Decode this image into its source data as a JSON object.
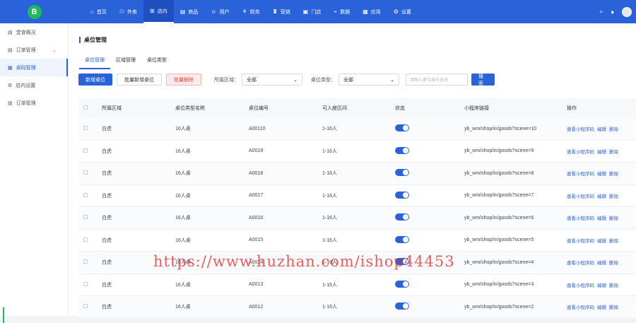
{
  "colors": {
    "primary": "#2a63d9",
    "brand": "#1fb85c",
    "danger": "#e04848"
  },
  "logo": {
    "letter": "B"
  },
  "nav": [
    {
      "icon": "⌂",
      "label": "首页"
    },
    {
      "icon": "⚇",
      "label": "外卖"
    },
    {
      "icon": "⊞",
      "label": "店内"
    },
    {
      "icon": "▤",
      "label": "商品"
    },
    {
      "icon": "☺",
      "label": "用户"
    },
    {
      "icon": "⚘",
      "label": "财务"
    },
    {
      "icon": "♜",
      "label": "营销"
    },
    {
      "icon": "▣",
      "label": "门店"
    },
    {
      "icon": "⌁",
      "label": "数据"
    },
    {
      "icon": "▦",
      "label": "应用"
    },
    {
      "icon": "⚙",
      "label": "设置"
    }
  ],
  "nav_active_index": 2,
  "sidebar": {
    "items": [
      {
        "icon": "▤",
        "label": "堂食概况"
      },
      {
        "icon": "▤",
        "label": "订单管理",
        "arrow": "⌄"
      },
      {
        "icon": "▦",
        "label": "桌码管理"
      },
      {
        "icon": "⚙",
        "label": "店内设置"
      },
      {
        "icon": "▤",
        "label": "订单管理"
      }
    ]
  },
  "page": {
    "title": "桌位管理"
  },
  "tabs": [
    "桌位管理",
    "区域管理",
    "桌位类型"
  ],
  "toolbar": {
    "add": "新增桌位",
    "batch_add": "批量新增桌位",
    "batch_delete": "批量删除",
    "area_label": "所属区域：",
    "area_value": "全部",
    "type_label": "桌位类型：",
    "type_value": "全部",
    "search_placeholder": "请输入桌位编号查询",
    "search": "搜索"
  },
  "table": {
    "headers": [
      "所属区域",
      "桌位类型名称",
      "桌位编号",
      "可入座区间",
      "状态",
      "小程序链接",
      "操作"
    ],
    "actions": {
      "view": "查看小程序码",
      "edit": "编辑",
      "delete": "删除"
    },
    "rows": [
      {
        "area": "白虎",
        "type": "16人桌",
        "code": "A00110",
        "range": "1-16人",
        "link": "yb_wm/shop/in/goods?scene=10"
      },
      {
        "area": "白虎",
        "type": "16人桌",
        "code": "A0019",
        "range": "1-16人",
        "link": "yb_wm/shop/in/goods?scene=9"
      },
      {
        "area": "白虎",
        "type": "16人桌",
        "code": "A0018",
        "range": "1-16人",
        "link": "yb_wm/shop/in/goods?scene=8"
      },
      {
        "area": "白虎",
        "type": "16人桌",
        "code": "A0017",
        "range": "1-16人",
        "link": "yb_wm/shop/in/goods?scene=7"
      },
      {
        "area": "白虎",
        "type": "16人桌",
        "code": "A0016",
        "range": "1-16人",
        "link": "yb_wm/shop/in/goods?scene=6"
      },
      {
        "area": "白虎",
        "type": "16人桌",
        "code": "A0015",
        "range": "1-16人",
        "link": "yb_wm/shop/in/goods?scene=5"
      },
      {
        "area": "白虎",
        "type": "16人桌",
        "code": "A0014",
        "range": "1-16人",
        "link": "yb_wm/shop/in/goods?scene=4"
      },
      {
        "area": "白虎",
        "type": "16人桌",
        "code": "A0013",
        "range": "1-16人",
        "link": "yb_wm/shop/in/goods?scene=3"
      },
      {
        "area": "白虎",
        "type": "16人桌",
        "code": "A0012",
        "range": "1-16人",
        "link": "yb_wm/shop/in/goods?scene=2"
      }
    ]
  },
  "watermark": "https://www.huzhan.com/ishop44453"
}
